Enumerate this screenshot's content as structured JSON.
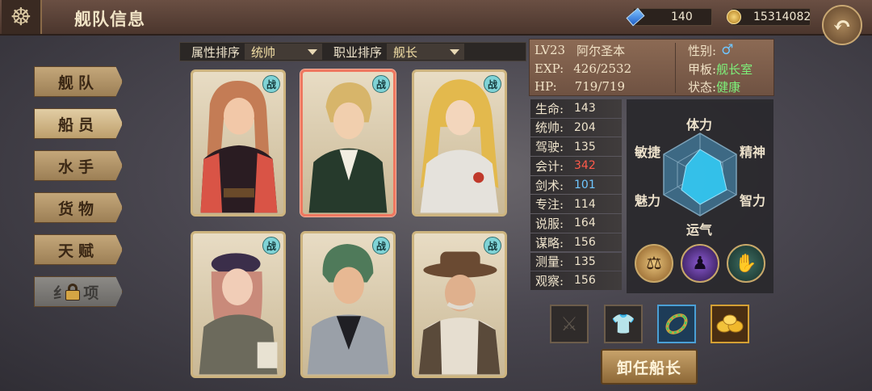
{
  "header": {
    "title": "舰队信息",
    "gems": "140",
    "coins": "15314082",
    "wheel_icon": "ship-wheel-icon",
    "back_icon": "back-arrow-icon"
  },
  "nav": [
    {
      "label": "舰队",
      "active": false,
      "locked": false
    },
    {
      "label": "船员",
      "active": true,
      "locked": false
    },
    {
      "label": "水手",
      "active": false,
      "locked": false
    },
    {
      "label": "货物",
      "active": false,
      "locked": false
    },
    {
      "label": "天赋",
      "active": false,
      "locked": false
    },
    {
      "label": "纟 项",
      "active": false,
      "locked": true
    }
  ],
  "sort": {
    "attr_label": "属性排序",
    "attr_value": "统帅",
    "job_label": "职业排序",
    "job_value": "舰长"
  },
  "cards": [
    {
      "badge": "战",
      "selected": false
    },
    {
      "badge": "战",
      "selected": true
    },
    {
      "badge": "战",
      "selected": false
    },
    {
      "badge": "战",
      "selected": false
    },
    {
      "badge": "战",
      "selected": false
    },
    {
      "badge": "战",
      "selected": false
    }
  ],
  "info": {
    "level": "LV23",
    "name": "阿尔圣本",
    "exp_label": "EXP:",
    "exp_value": "426/2532",
    "hp_label": "HP:",
    "hp_value": "719/719",
    "gender_label": "性别:",
    "gender_value": "♂",
    "deck_label": "甲板:",
    "deck_value": "舰长室",
    "status_label": "状态:",
    "status_value": "健康"
  },
  "stats": [
    {
      "label": "生命:",
      "value": "143",
      "color": "#efe4cc"
    },
    {
      "label": "统帅:",
      "value": "204",
      "color": "#efe4cc"
    },
    {
      "label": "驾驶:",
      "value": "135",
      "color": "#efe4cc"
    },
    {
      "label": "会计:",
      "value": "342",
      "color": "#ff5a4a"
    },
    {
      "label": "剑术:",
      "value": "101",
      "color": "#6fc6ff"
    },
    {
      "label": "专注:",
      "value": "114",
      "color": "#efe4cc"
    },
    {
      "label": "说服:",
      "value": "164",
      "color": "#efe4cc"
    },
    {
      "label": "谋略:",
      "value": "156",
      "color": "#efe4cc"
    },
    {
      "label": "测量:",
      "value": "135",
      "color": "#efe4cc"
    },
    {
      "label": "观察:",
      "value": "156",
      "color": "#efe4cc"
    }
  ],
  "radar": {
    "labels": {
      "top": "体力",
      "upper_right": "精神",
      "lower_right": "智力",
      "bottom": "运气",
      "lower_left": "魅力",
      "upper_left": "敏捷"
    }
  },
  "skills": [
    {
      "icon": "scales-icon"
    },
    {
      "icon": "shadow-figure-icon"
    },
    {
      "icon": "coin-hand-icon"
    }
  ],
  "equipment": [
    {
      "icon": "sword-slot-icon"
    },
    {
      "icon": "armor-slot-icon"
    },
    {
      "icon": "emerald-ring-icon"
    },
    {
      "icon": "gold-nuggets-icon"
    }
  ],
  "action": {
    "label": "卸任船长"
  }
}
